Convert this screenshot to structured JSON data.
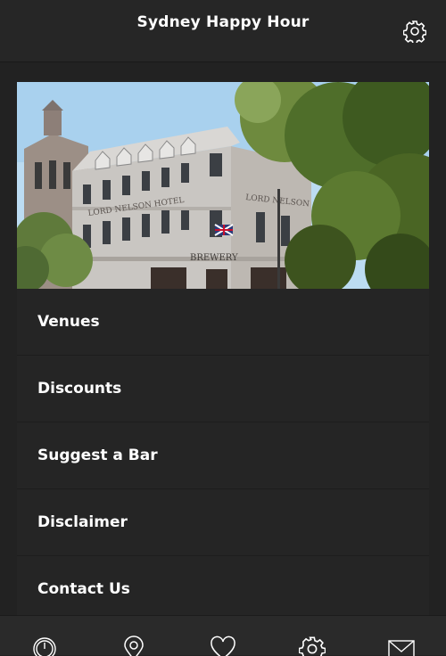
{
  "header": {
    "title": "Sydney Happy Hour",
    "settings_icon": "gear-icon"
  },
  "hero": {
    "image": "photo of the Lord Nelson Hotel sandstone pub building",
    "signs": [
      "LORD NELSON HOTEL",
      "LORD NELSON",
      "BREWERY"
    ]
  },
  "menu": {
    "items": [
      {
        "label": "Venues"
      },
      {
        "label": "Discounts"
      },
      {
        "label": "Suggest a Bar"
      },
      {
        "label": "Disclaimer"
      },
      {
        "label": "Contact Us"
      }
    ]
  },
  "tabbar": {
    "tabs": [
      {
        "icon": "speedometer-icon"
      },
      {
        "icon": "map-pin-icon"
      },
      {
        "icon": "heart-icon"
      },
      {
        "icon": "gear-icon"
      },
      {
        "icon": "envelope-icon"
      }
    ]
  },
  "colors": {
    "background": "#222222",
    "header": "#262626",
    "menu_item": "#252525",
    "text": "#ffffff"
  }
}
